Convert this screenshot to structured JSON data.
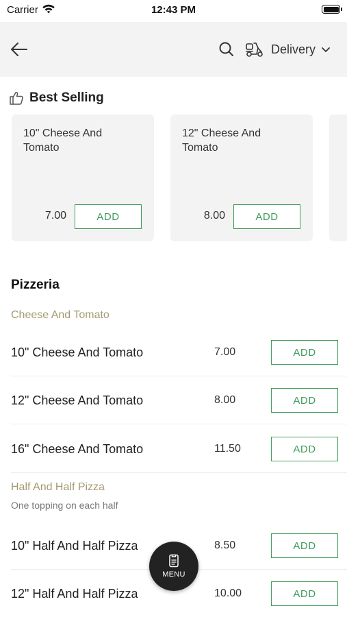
{
  "status_bar": {
    "carrier": "Carrier",
    "time": "12:43 PM"
  },
  "nav": {
    "delivery_label": "Delivery",
    "icons": [
      "back-arrow-icon",
      "search-icon",
      "scooter-icon",
      "chevron-down-icon"
    ]
  },
  "best_selling": {
    "title": "Best Selling",
    "items": [
      {
        "name": "10\" Cheese And Tomato",
        "price": "7.00",
        "add_label": "ADD"
      },
      {
        "name": "12\" Cheese And Tomato",
        "price": "8.00",
        "add_label": "ADD"
      }
    ]
  },
  "section": {
    "title": "Pizzeria",
    "categories": [
      {
        "title": "Cheese And Tomato",
        "items": [
          {
            "name": "10\" Cheese And Tomato",
            "price": "7.00",
            "add_label": "ADD"
          },
          {
            "name": "12\" Cheese And Tomato",
            "price": "8.00",
            "add_label": "ADD"
          },
          {
            "name": "16\" Cheese And Tomato",
            "price": "11.50",
            "add_label": "ADD"
          }
        ]
      },
      {
        "title": "Half And Half Pizza",
        "description": "One topping on each half",
        "items": [
          {
            "name": "10\" Half And Half Pizza",
            "price": "8.50",
            "add_label": "ADD"
          },
          {
            "name": "12\" Half And Half Pizza",
            "price": "10.00",
            "add_label": "ADD"
          }
        ]
      }
    ]
  },
  "fab": {
    "label": "MENU"
  },
  "colors": {
    "accent_green": "#3f9b5b",
    "category_gold": "#a49a70",
    "nav_background": "#f3f3f3",
    "fab_background": "#222222"
  }
}
